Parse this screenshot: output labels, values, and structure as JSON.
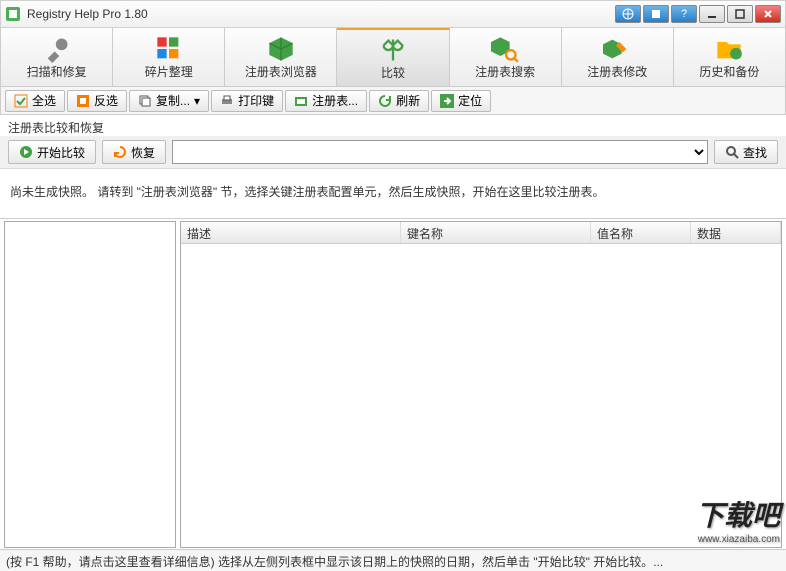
{
  "window": {
    "title": "Registry Help Pro 1.80"
  },
  "tabs": [
    {
      "label": "扫描和修复"
    },
    {
      "label": "碎片整理"
    },
    {
      "label": "注册表浏览器"
    },
    {
      "label": "比较"
    },
    {
      "label": "注册表搜索"
    },
    {
      "label": "注册表修改"
    },
    {
      "label": "历史和备份"
    }
  ],
  "toolbar": {
    "select_all": "全选",
    "invert": "反选",
    "copy": "复制...",
    "print": "打印键",
    "regedit": "注册表...",
    "refresh": "刷新",
    "locate": "定位"
  },
  "section": {
    "label": "注册表比较和恢复"
  },
  "actions": {
    "start_compare": "开始比较",
    "restore": "恢复",
    "search": "查找"
  },
  "info": "尚未生成快照。 请转到 \"注册表浏览器\" 节，选择关键注册表配置单元，然后生成快照，开始在这里比较注册表。",
  "grid": {
    "cols": {
      "desc": "描述",
      "keyname": "键名称",
      "valuename": "值名称",
      "data": "数据"
    }
  },
  "statusbar": "(按 F1 帮助，请点击这里查看详细信息) 选择从左侧列表框中显示该日期上的快照的日期，然后单击 \"开始比较\" 开始比较。...",
  "watermark": {
    "main": "下载吧",
    "sub": "www.xiazaiba.com"
  }
}
